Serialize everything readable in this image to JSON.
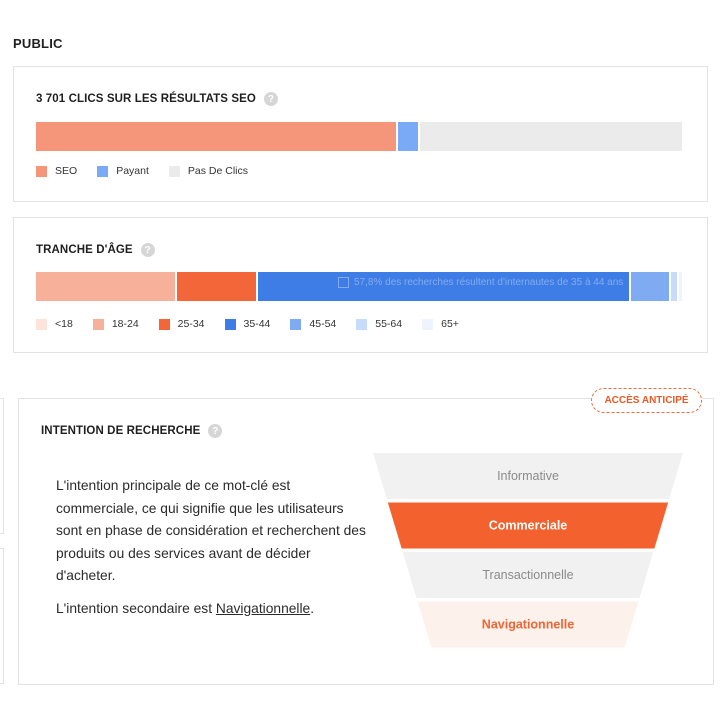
{
  "section_title": "PUBLIC",
  "clicks": {
    "title": "3 701 CLICS SUR LES RÉSULTATS SEO",
    "help_icon": "question-circle-icon",
    "segments": [
      {
        "label": "SEO",
        "value": 56,
        "color": "#f5967a"
      },
      {
        "label": "Payant",
        "value": 3.5,
        "color": "#7aaaf5"
      },
      {
        "label": "Pas De Clics",
        "value": 40.5,
        "color": "#ebebeb"
      }
    ]
  },
  "age": {
    "title": "TRANCHE D'ÂGE",
    "help_icon": "question-circle-icon",
    "segments": [
      {
        "label": "<18",
        "value": 0,
        "color": "#fde3d8"
      },
      {
        "label": "18-24",
        "value": 21.8,
        "color": "#f7b19b"
      },
      {
        "label": "25-34",
        "value": 12.5,
        "color": "#f2663a"
      },
      {
        "label": "35-44",
        "value": 57.8,
        "color": "#3e7de6"
      },
      {
        "label": "45-54",
        "value": 6.2,
        "color": "#7eabf2"
      },
      {
        "label": "55-64",
        "value": 1.2,
        "color": "#c7dbfa"
      },
      {
        "label": "65+",
        "value": 0.5,
        "color": "#eef3fd"
      }
    ],
    "tooltip": "57,8% des recherches résultent d'internautes de 35 à 44 ans"
  },
  "intent": {
    "badge": "ACCÈS ANTICIPÉ",
    "title": "INTENTION DE RECHERCHE",
    "help_icon": "question-circle-icon",
    "description": "L'intention principale de ce mot-clé est commerciale, ce qui signifie que les utilisateurs sont en phase de considération et recherchent des produits ou des services avant de décider d'acheter.",
    "secondary_prefix": "L'intention secondaire est ",
    "secondary_link": "Navigationnelle",
    "secondary_suffix": ".",
    "funnel": [
      {
        "label": "Informative",
        "fill": "#f1f1f1",
        "text": "#8a8a8a",
        "weight": "400"
      },
      {
        "label": "Commerciale",
        "fill": "#f2612e",
        "text": "#ffffff",
        "weight": "700"
      },
      {
        "label": "Transactionnelle",
        "fill": "#f1f1f1",
        "text": "#8a8a8a",
        "weight": "400"
      },
      {
        "label": "Navigationnelle",
        "fill": "#fdf1ec",
        "text": "#ef6534",
        "weight": "700"
      }
    ]
  }
}
